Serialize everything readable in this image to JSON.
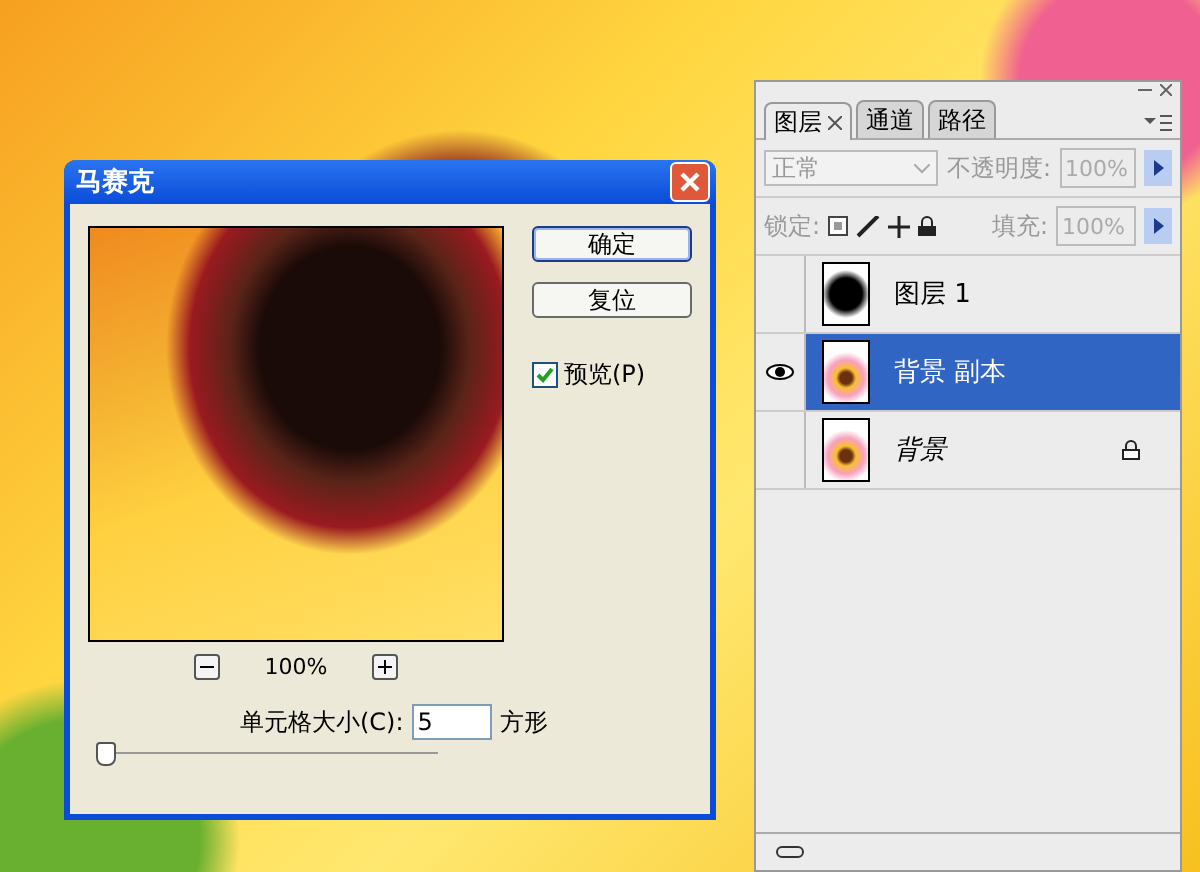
{
  "dialog": {
    "title": "马赛克",
    "buttons": [
      {
        "label": "确定",
        "selected": true
      },
      {
        "label": "复位",
        "selected": false
      }
    ],
    "preview": {
      "label": "预览(P)",
      "checked": true
    },
    "zoom": "100%",
    "cell_size": {
      "label": "单元格大小(C):",
      "value": "5",
      "unit": "方形",
      "level": 0.02
    }
  },
  "layers_panel": {
    "tabs": [
      {
        "label": "图层",
        "selected": true,
        "closable": true
      },
      {
        "label": "通道",
        "selected": false,
        "closable": false
      },
      {
        "label": "路径",
        "selected": false,
        "closable": false
      }
    ],
    "blend_mode": {
      "value": "正常",
      "disabled": true
    },
    "opacity": {
      "label": "不透明度:",
      "value": "100%"
    },
    "lock": {
      "label": "锁定:"
    },
    "fill": {
      "label": "填充:",
      "value": "100%"
    },
    "layers": [
      {
        "name": "图层 1",
        "kind": "mask",
        "visible": false,
        "selected": false,
        "locked": false
      },
      {
        "name": "背景 副本",
        "kind": "photo",
        "visible": true,
        "selected": true,
        "locked": false
      },
      {
        "name": "背景",
        "kind": "background",
        "visible": false,
        "selected": false,
        "locked": true
      }
    ]
  }
}
